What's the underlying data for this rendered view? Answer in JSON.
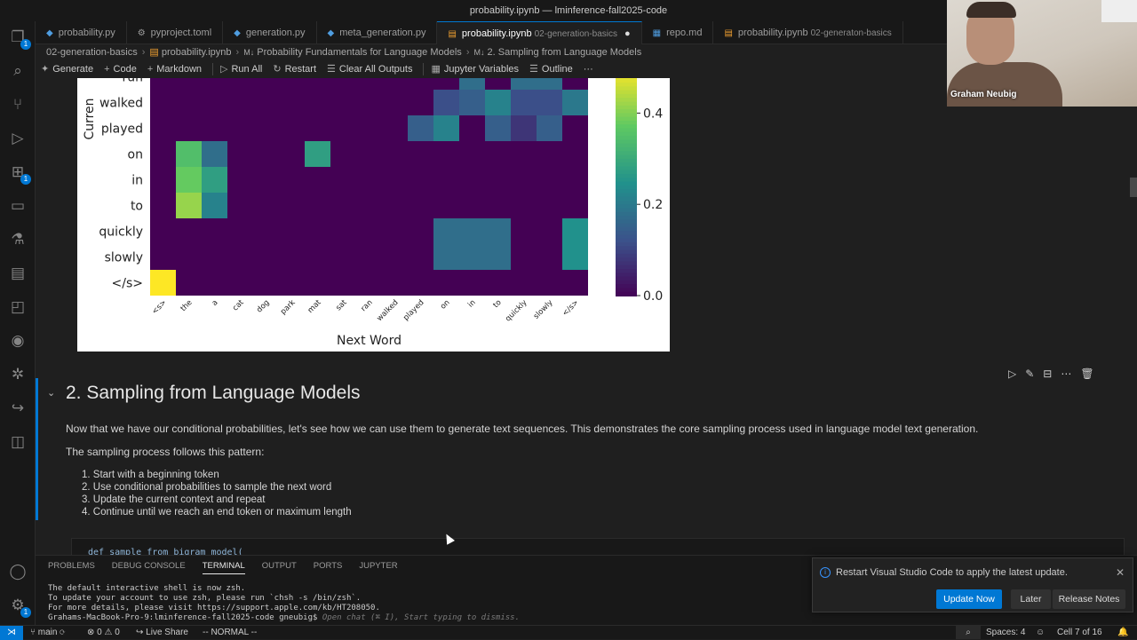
{
  "window": {
    "title": "probability.ipynb — lminference-fall2025-code"
  },
  "activity_bar": {
    "explorer_badge": "1",
    "extensions_badge": "1",
    "accounts_badge": "1"
  },
  "tabs": [
    {
      "label": "probability.py",
      "sub": ""
    },
    {
      "label": "pyproject.toml",
      "sub": ""
    },
    {
      "label": "generation.py",
      "sub": ""
    },
    {
      "label": "meta_generation.py",
      "sub": ""
    },
    {
      "label": "probability.ipynb",
      "sub": "02-generation-basics",
      "dirty": "●"
    },
    {
      "label": "repo.md",
      "sub": ""
    },
    {
      "label": "probability.ipynb",
      "sub": "02-generaton-basics"
    }
  ],
  "breadcrumb": {
    "folder": "02-generation-basics",
    "file": "probability.ipynb",
    "md_section": "Probability Fundamentals for Language Models",
    "md_subsection": "2. Sampling from Language Models",
    "md_badge": "M↓"
  },
  "toolbar": {
    "generate": "Generate",
    "code": "Code",
    "markdown": "Markdown",
    "run_all": "Run All",
    "restart": "Restart",
    "clear_all": "Clear All Outputs",
    "variables": "Jupyter Variables",
    "outline": "Outline",
    "more": "···"
  },
  "chart_data": {
    "type": "heatmap",
    "xlabel": "Next Word",
    "ylabel": "Curren",
    "row_labels_visible": [
      "run",
      "walked",
      "played",
      "on",
      "in",
      "to",
      "quickly",
      "slowly",
      "</s>"
    ],
    "col_labels": [
      "<s>",
      "the",
      "a",
      "cat",
      "dog",
      "park",
      "mat",
      "sat",
      "ran",
      "walked",
      "played",
      "on",
      "in",
      "to",
      "quickly",
      "slowly",
      "</s>"
    ],
    "colorbar_ticks": [
      "0.0",
      "0.2",
      "0.4"
    ],
    "colorbar_range": [
      0,
      0.5
    ],
    "colormap": "viridis",
    "values": [
      [
        0,
        0,
        0,
        0,
        0,
        0,
        0,
        0,
        0,
        0,
        0,
        0,
        0.18,
        0,
        0.18,
        0.18,
        0
      ],
      [
        0,
        0,
        0,
        0,
        0,
        0,
        0,
        0,
        0,
        0,
        0,
        0.12,
        0.15,
        0.22,
        0.12,
        0.12,
        0.2
      ],
      [
        0,
        0,
        0,
        0,
        0,
        0,
        0,
        0,
        0,
        0,
        0.15,
        0.22,
        0,
        0.15,
        0.08,
        0.15,
        0
      ],
      [
        0,
        0.35,
        0.18,
        0,
        0,
        0,
        0.28,
        0,
        0,
        0,
        0,
        0,
        0,
        0,
        0,
        0,
        0
      ],
      [
        0,
        0.38,
        0.28,
        0,
        0,
        0,
        0,
        0,
        0,
        0,
        0,
        0,
        0,
        0,
        0,
        0,
        0
      ],
      [
        0,
        0.42,
        0.22,
        0,
        0,
        0,
        0,
        0,
        0,
        0,
        0,
        0,
        0,
        0,
        0,
        0,
        0
      ],
      [
        0,
        0,
        0,
        0,
        0,
        0,
        0,
        0,
        0,
        0,
        0,
        0.18,
        0.18,
        0.18,
        0,
        0,
        0.25
      ],
      [
        0,
        0,
        0,
        0,
        0,
        0,
        0,
        0,
        0,
        0,
        0,
        0.18,
        0.18,
        0.18,
        0,
        0,
        0.25
      ],
      [
        0.5,
        0,
        0,
        0,
        0,
        0,
        0,
        0,
        0,
        0,
        0,
        0,
        0,
        0,
        0,
        0,
        0
      ]
    ]
  },
  "cell_actions": {
    "icons": [
      "run-icon",
      "edit-icon",
      "split-icon",
      "more-icon",
      "delete-icon"
    ]
  },
  "markdown_cell": {
    "heading": "2. Sampling from Language Models",
    "para1": "Now that we have our conditional probabilities, let's see how we can use them to generate text sequences. This demonstrates the core sampling process used in language model text generation.",
    "para2": "The sampling process follows this pattern:",
    "steps": [
      "1. Start with a beginning token",
      "2. Use conditional probabilities to sample the next word",
      "3. Update the current context and repeat",
      "4. Continue until we reach an end token or maximum length"
    ]
  },
  "code_cell_peek": "def sample_from_bigram_model(",
  "panel": {
    "tabs": [
      "PROBLEMS",
      "DEBUG CONSOLE",
      "TERMINAL",
      "OUTPUT",
      "PORTS",
      "JUPYTER"
    ],
    "active_tab": "TERMINAL",
    "terminal_lines": [
      "The default interactive shell is now zsh.",
      "To update your account to use zsh, please run `chsh -s /bin/zsh`.",
      "For more details, please visit https://support.apple.com/kb/HT208050.",
      "Grahams-MacBook-Pro-9:lminference-fall2025-code gneubig$ "
    ],
    "terminal_hint": "Open chat (⌘ I), Start typing to dismiss."
  },
  "notification": {
    "message": "Restart Visual Studio Code to apply the latest update.",
    "primary": "Update Now",
    "later": "Later",
    "notes": "Release Notes"
  },
  "statusbar": {
    "branch": "main",
    "problems": "⊗ 0 ⚠ 0",
    "liveshare": "Live Share",
    "mode": "-- NORMAL --",
    "spaces": "Spaces: 4",
    "cell": "Cell 7 of 16"
  },
  "webcam": {
    "name": "Graham Neubig"
  },
  "colors": {
    "accent": "#0078d4",
    "editor_bg": "#1f1f1f",
    "chrome_bg": "#181818"
  }
}
